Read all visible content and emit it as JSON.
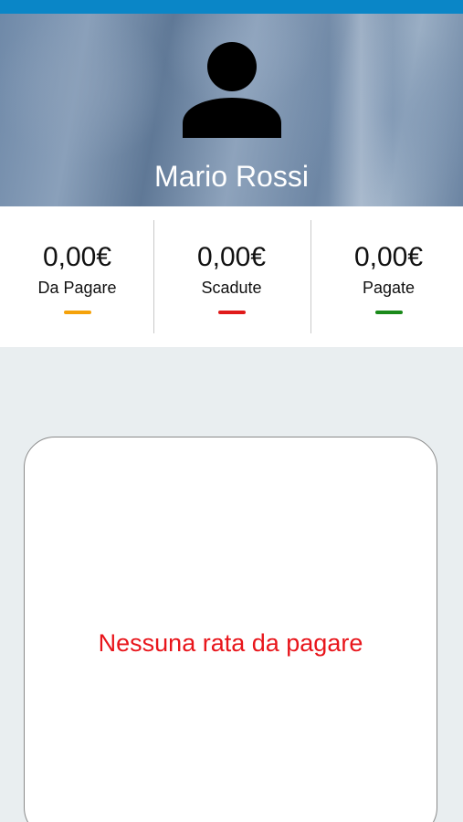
{
  "profile": {
    "name": "Mario Rossi",
    "avatar_icon": "user-silhouette-icon"
  },
  "summary": [
    {
      "amount": "0,00€",
      "label": "Da Pagare",
      "color": "#f5a20a"
    },
    {
      "amount": "0,00€",
      "label": "Scadute",
      "color": "#e01a1a"
    },
    {
      "amount": "0,00€",
      "label": "Pagate",
      "color": "#1a8a1a"
    }
  ],
  "installments": {
    "empty_message": "Nessuna rata da pagare"
  },
  "colors": {
    "status_bar": "#0a86c7",
    "empty_message": "#e8151b",
    "background": "#e9eef0"
  }
}
